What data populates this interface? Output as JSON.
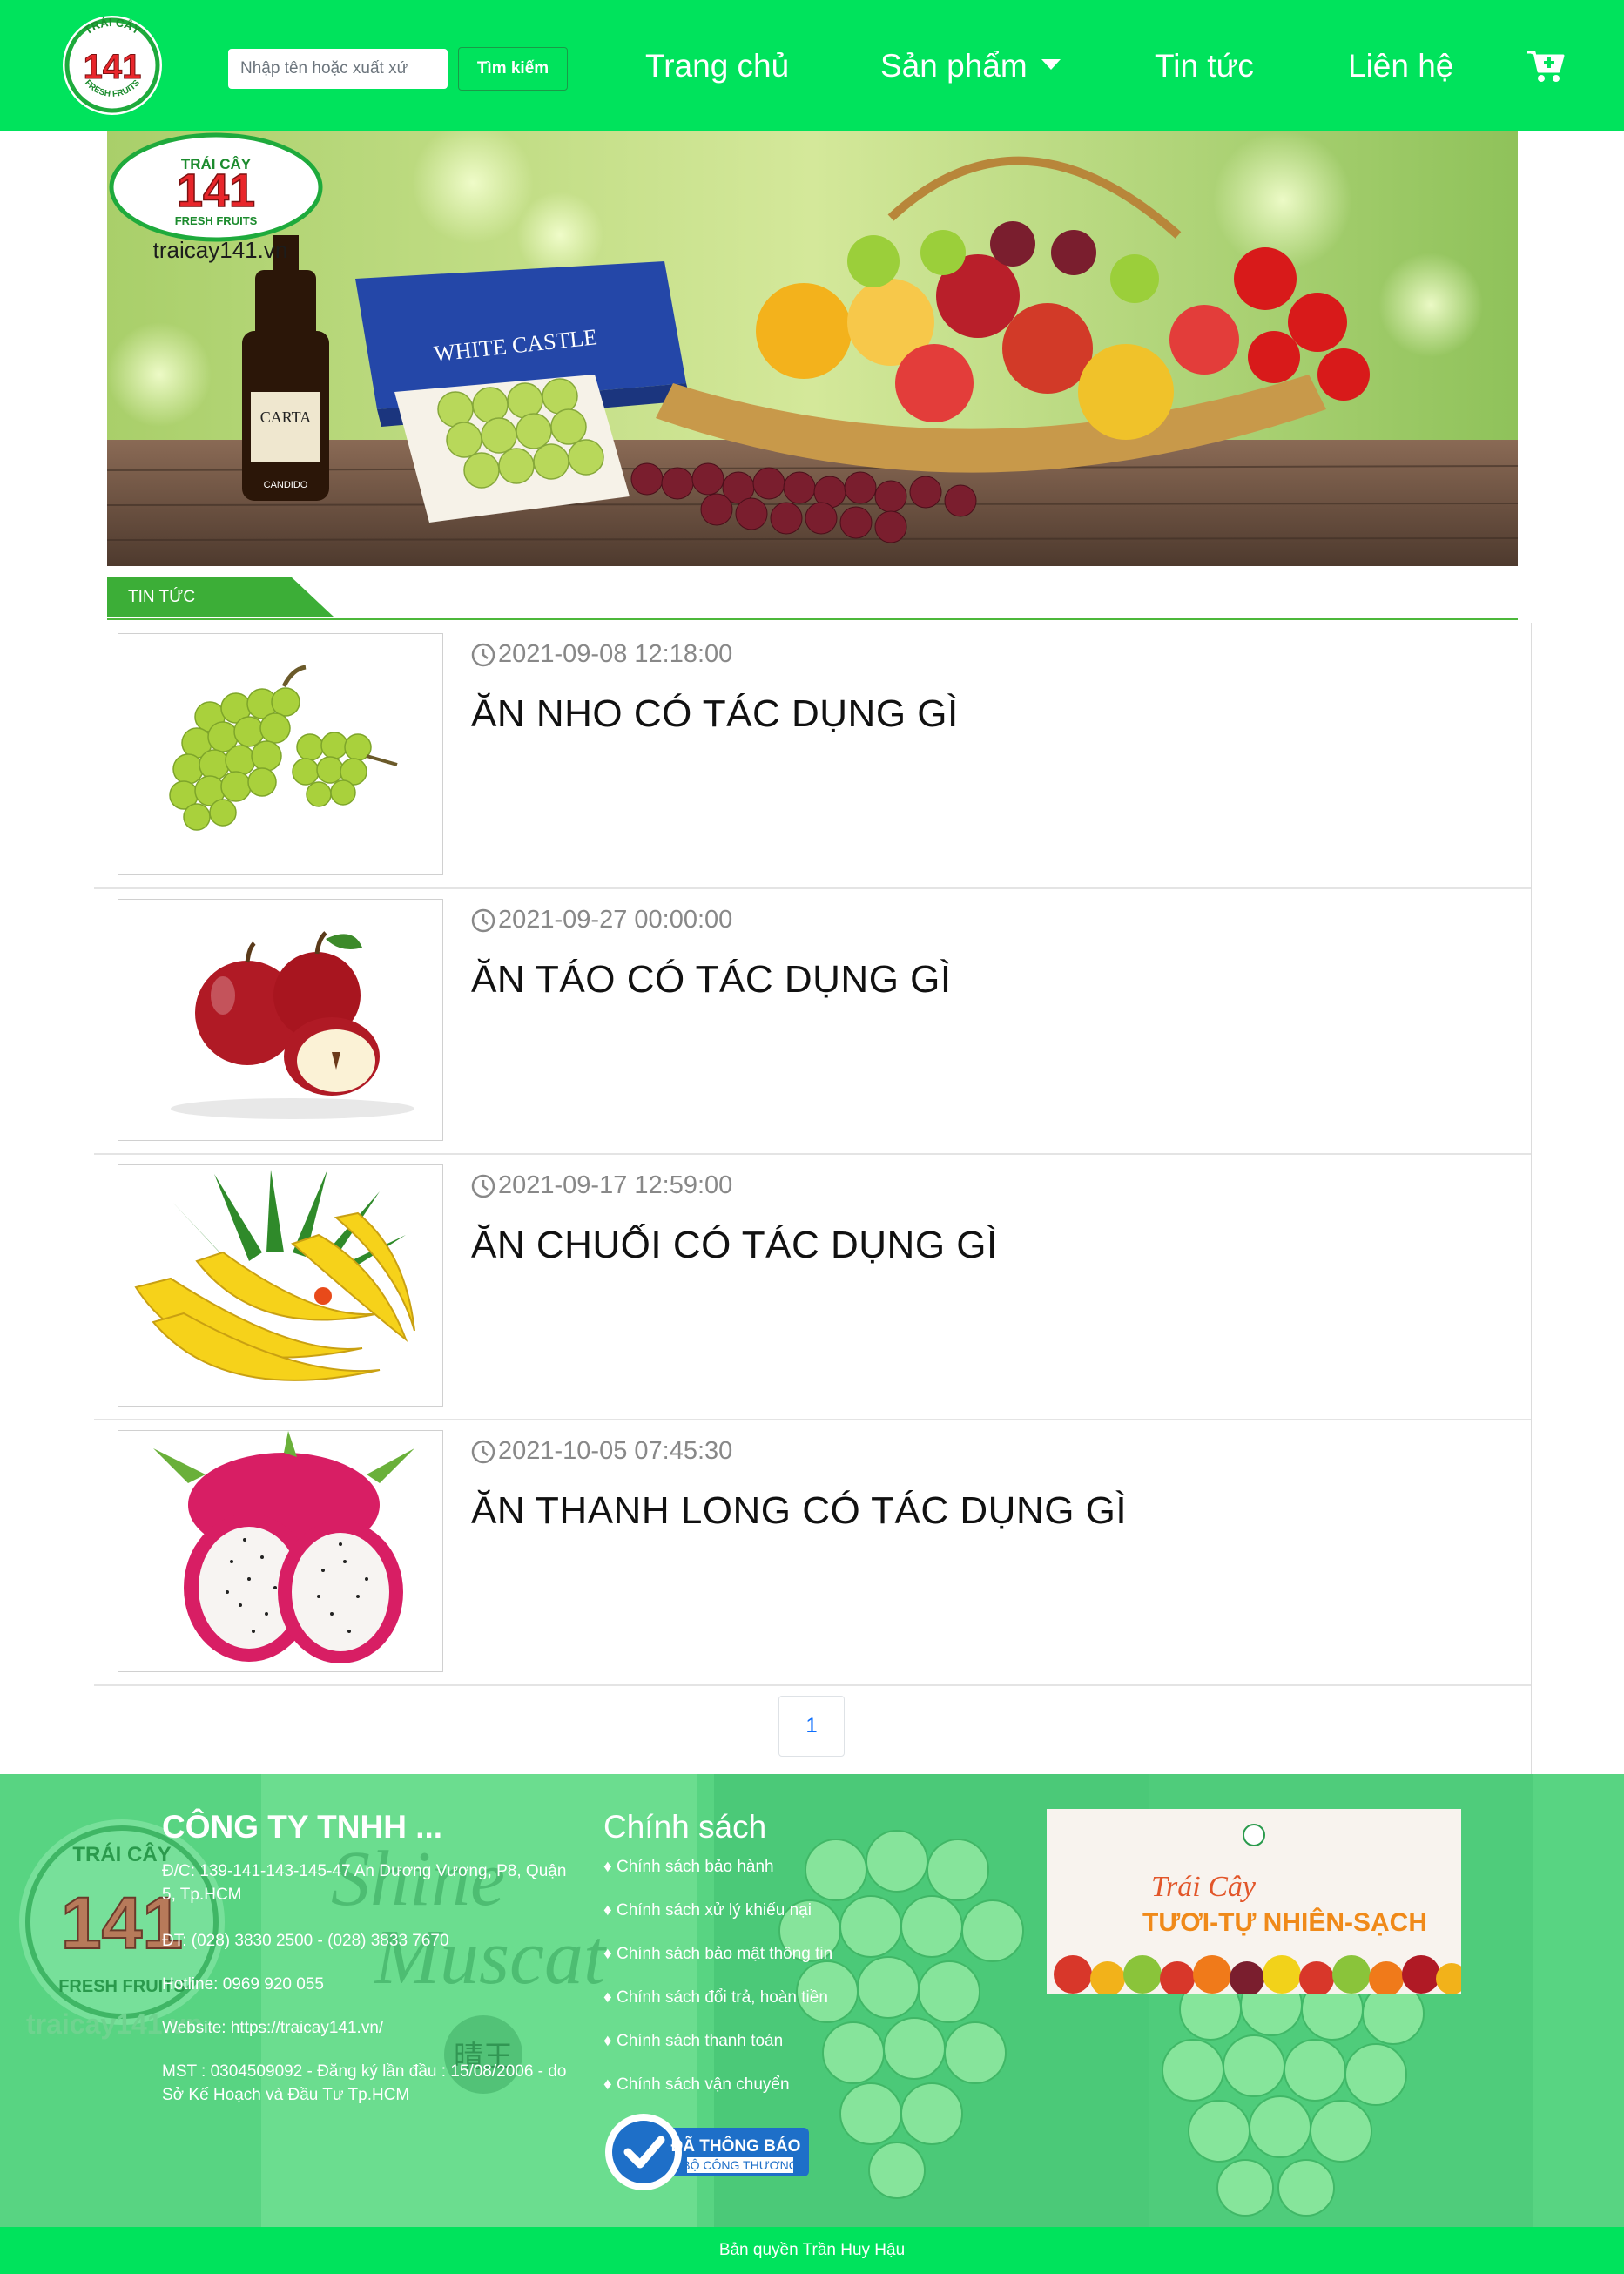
{
  "header": {
    "logo_text": {
      "top": "TRÁI CÂY",
      "number": "141",
      "bottom": "FRESH FRUITS"
    },
    "search": {
      "placeholder": "Nhập tên hoặc xuất xứ",
      "value": "",
      "button_label": "Tìm kiếm"
    },
    "nav": {
      "home": "Trang chủ",
      "products": "Sản phẩm",
      "news": "Tin tức",
      "contact": "Liên hệ"
    },
    "cart_icon": "cart-plus-icon"
  },
  "banner": {
    "logo_text": {
      "top": "TRÁI CÂY",
      "number": "141",
      "bottom": "FRESH FRUITS"
    },
    "site": "traicay141.vn",
    "box_text": "WHITE CASTLE",
    "wine_label": "CARTA",
    "wine_brand": "CANDIDO"
  },
  "section": {
    "title": "TIN TỨC"
  },
  "news": [
    {
      "date": "2021-09-08 12:18:00",
      "title": "ĂN NHO CÓ TÁC DỤNG GÌ",
      "image": "green-grapes"
    },
    {
      "date": "2021-09-27 00:00:00",
      "title": "ĂN TÁO CÓ TÁC DỤNG GÌ",
      "image": "red-apples"
    },
    {
      "date": "2021-09-17 12:59:00",
      "title": "ĂN CHUỐI CÓ TÁC DỤNG GÌ",
      "image": "bananas"
    },
    {
      "date": "2021-10-05 07:45:30",
      "title": "ĂN THANH LONG CÓ TÁC DỤNG GÌ",
      "image": "dragon-fruit"
    }
  ],
  "pagination": {
    "current": "1"
  },
  "footer": {
    "logo_text": {
      "top": "TRÁI CÂY",
      "number": "141",
      "bottom": "FRESH FRUITS"
    },
    "site": "traicay141.vn",
    "bg_text": {
      "line1": "Shine",
      "line2": "Muscat",
      "stamp": "晴王"
    },
    "company": "CÔNG TY TNHH ...",
    "address": "Đ/C: 139-141-143-145-47 An Dương Vương, P8, Quận 5, Tp.HCM",
    "phone": "ĐT: (028) 3830 2500 - (028) 3833 7670",
    "hotline": "Hotline: 0969 920 055",
    "website": "Website: https://traicay141.vn/",
    "tax": "MST : 0304509092 - Đăng ký lần đầu : 15/08/2006 - do Sở Kế Hoạch và Đầu Tư Tp.HCM",
    "policy_heading": "Chính sách",
    "policies": [
      "♦ Chính sách bảo hành",
      "♦ Chính sách xử lý khiếu nại",
      "♦ Chính sách bảo mật thông tin",
      "♦ Chính sách đổi trả, hoàn tiền",
      "♦ Chính sách thanh toán",
      "♦ Chính sách vận chuyển"
    ],
    "badge": {
      "line1": "ĐÃ THÔNG BÁO",
      "line2": "BỘ CÔNG THƯƠNG"
    },
    "promo": {
      "line1": "Trái Cây",
      "line2": "TƯƠI-TỰ NHIÊN-SẠCH"
    }
  },
  "copyright": "Bản quyền Trần Huy Hậu",
  "colors": {
    "brand_green": "#00e35c",
    "section_green": "#3cae37",
    "logo_red": "#e8262b"
  }
}
